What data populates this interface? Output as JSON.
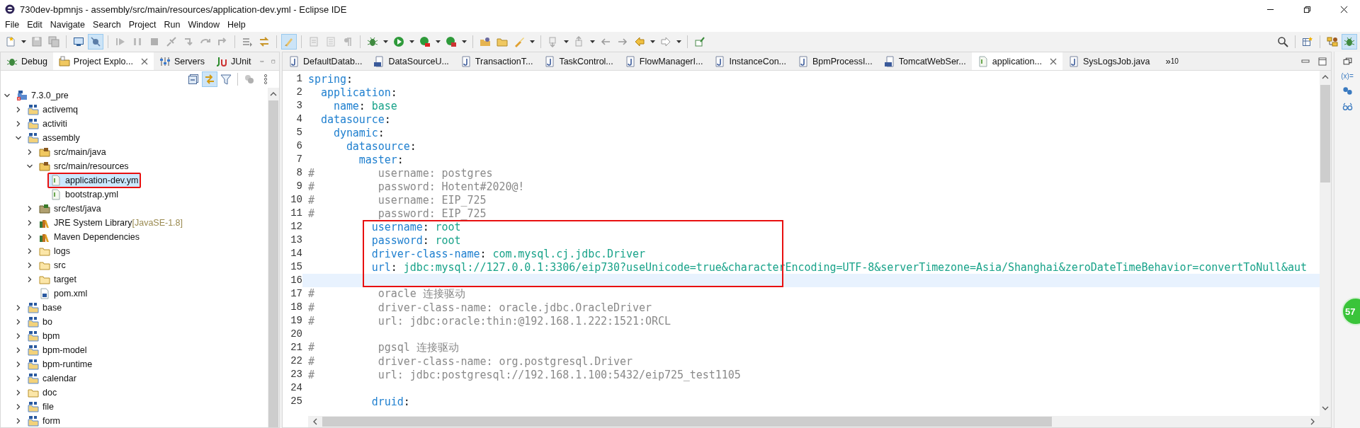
{
  "window": {
    "title": "730dev-bpmnjs - assembly/src/main/resources/application-dev.yml - Eclipse IDE"
  },
  "menu": [
    {
      "label": "File"
    },
    {
      "label": "Edit"
    },
    {
      "label": "Navigate"
    },
    {
      "label": "Search"
    },
    {
      "label": "Project"
    },
    {
      "label": "Run"
    },
    {
      "label": "Window"
    },
    {
      "label": "Help"
    }
  ],
  "toolbar": [
    {
      "on": false
    },
    {
      "on": false
    },
    {
      "on": false
    },
    {
      "on": false
    },
    {
      "on": true
    },
    {
      "on": false
    },
    {
      "on": false
    },
    {
      "on": false
    },
    {
      "on": false
    },
    {
      "on": false
    },
    {
      "on": false
    },
    {
      "on": false
    },
    {
      "on": false
    },
    {
      "on": false
    },
    {
      "on": true
    },
    {
      "on": false
    },
    {
      "on": false
    },
    {
      "on": false
    },
    {
      "on": false
    },
    {
      "on": false
    },
    {
      "on": false
    },
    {
      "on": false
    },
    {
      "on": false
    },
    {
      "on": false
    },
    {
      "on": false
    },
    {
      "on": false
    },
    {
      "on": false
    },
    {
      "on": false
    },
    {
      "on": false
    },
    {
      "on": false
    },
    {
      "on": false
    },
    {
      "on": false
    }
  ],
  "perspectives": [
    {
      "selected": false
    },
    {
      "selected": true
    }
  ],
  "left_panel": {
    "tabs": [
      {
        "label": "Debug",
        "kind": "debug",
        "selected": false
      },
      {
        "label": "Project Explo...",
        "kind": "explorer",
        "selected": true
      },
      {
        "label": "Servers",
        "kind": "servers",
        "selected": false
      },
      {
        "label": "JUnit",
        "kind": "junit",
        "selected": false
      }
    ],
    "tree": [
      {
        "label": "7.3.0_pre",
        "kind": "root",
        "expanded": true,
        "selected": false,
        "boxed": false,
        "children": [
          {
            "label": "activemq",
            "kind": "project",
            "expanded": false,
            "selected": false,
            "boxed": false
          },
          {
            "label": "activiti",
            "kind": "project",
            "expanded": false,
            "selected": false,
            "boxed": false
          },
          {
            "label": "assembly",
            "kind": "project",
            "expanded": true,
            "selected": false,
            "boxed": false,
            "children": [
              {
                "label": "src/main/java",
                "kind": "source",
                "expanded": false,
                "selected": false,
                "boxed": false
              },
              {
                "label": "src/main/resources",
                "kind": "source",
                "expanded": true,
                "selected": false,
                "boxed": false,
                "children": [
                  {
                    "label": "application-dev.ym",
                    "kind": "yml",
                    "selected": true,
                    "boxed": true
                  },
                  {
                    "label": "bootstrap.yml",
                    "kind": "yml",
                    "selected": false,
                    "boxed": false
                  }
                ]
              },
              {
                "label": "src/test/java",
                "kind": "test-source",
                "expanded": false,
                "selected": false,
                "boxed": false
              },
              {
                "label": "JRE System Library",
                "decoration": "[JavaSE-1.8]",
                "kind": "library",
                "expanded": false,
                "selected": false,
                "boxed": false
              },
              {
                "label": "Maven Dependencies",
                "kind": "library",
                "expanded": false,
                "selected": false,
                "boxed": false
              },
              {
                "label": "logs",
                "kind": "folder",
                "expanded": false,
                "selected": false,
                "boxed": false
              },
              {
                "label": "src",
                "kind": "folder",
                "expanded": false,
                "selected": false,
                "boxed": false
              },
              {
                "label": "target",
                "kind": "folder",
                "expanded": false,
                "selected": false,
                "boxed": false
              },
              {
                "label": "pom.xml",
                "kind": "pom",
                "selected": false,
                "boxed": false
              }
            ]
          },
          {
            "label": "base",
            "kind": "project",
            "expanded": false,
            "selected": false,
            "boxed": false
          },
          {
            "label": "bo",
            "kind": "project",
            "expanded": false,
            "selected": false,
            "boxed": false
          },
          {
            "label": "bpm",
            "kind": "project",
            "expanded": false,
            "selected": false,
            "boxed": false
          },
          {
            "label": "bpm-model",
            "kind": "project",
            "expanded": false,
            "selected": false,
            "boxed": false
          },
          {
            "label": "bpm-runtime",
            "kind": "project",
            "expanded": false,
            "selected": false,
            "boxed": false
          },
          {
            "label": "calendar",
            "kind": "project",
            "expanded": false,
            "selected": false,
            "boxed": false
          },
          {
            "label": "doc",
            "kind": "folder",
            "expanded": false,
            "selected": false,
            "boxed": false
          },
          {
            "label": "file",
            "kind": "project",
            "expanded": false,
            "selected": false,
            "boxed": false
          },
          {
            "label": "form",
            "kind": "project",
            "expanded": false,
            "selected": false,
            "boxed": false
          }
        ]
      }
    ]
  },
  "editor": {
    "tabs": [
      {
        "label": "DefaultDatab...",
        "kind": "java",
        "selected": false
      },
      {
        "label": "DataSourceU...",
        "kind": "class",
        "selected": false
      },
      {
        "label": "TransactionT...",
        "kind": "java",
        "selected": false
      },
      {
        "label": "TaskControl...",
        "kind": "java",
        "selected": false
      },
      {
        "label": "FlowManagerI...",
        "kind": "java",
        "selected": false
      },
      {
        "label": "InstanceCon...",
        "kind": "java",
        "selected": false
      },
      {
        "label": "BpmProcessI...",
        "kind": "java",
        "selected": false
      },
      {
        "label": "TomcatWebSer...",
        "kind": "class",
        "selected": false
      },
      {
        "label": "application...",
        "kind": "yml",
        "selected": true
      },
      {
        "label": "SysLogsJob.java",
        "kind": "java",
        "selected": false
      }
    ],
    "overflow_mark": "»",
    "overflow_count": "10",
    "lines": [
      {
        "number": "1",
        "kind": "pair",
        "key": "spring",
        "sep": ":",
        "current": false,
        "boxed": false
      },
      {
        "number": "2",
        "kind": "pair",
        "key": "  application",
        "sep": ":",
        "current": false,
        "boxed": false
      },
      {
        "number": "3",
        "kind": "pair",
        "key": "    name",
        "sep": ":",
        "value": " base",
        "current": false,
        "boxed": false
      },
      {
        "number": "4",
        "kind": "pair",
        "key": "  datasource",
        "sep": ":",
        "current": false,
        "boxed": false
      },
      {
        "number": "5",
        "kind": "pair",
        "key": "    dynamic",
        "sep": ":",
        "current": false,
        "boxed": false
      },
      {
        "number": "6",
        "kind": "pair",
        "key": "      datasource",
        "sep": ":",
        "current": false,
        "boxed": false
      },
      {
        "number": "7",
        "kind": "pair",
        "key": "        master",
        "sep": ":",
        "current": false,
        "boxed": false
      },
      {
        "number": "8",
        "kind": "comment",
        "text": "#          username: postgres",
        "current": false,
        "boxed": false
      },
      {
        "number": "9",
        "kind": "comment",
        "text": "#          password: Hotent#2020@!",
        "current": false,
        "boxed": false
      },
      {
        "number": "10",
        "kind": "comment",
        "text": "#          username: EIP_725",
        "current": false,
        "boxed": false
      },
      {
        "number": "11",
        "kind": "comment",
        "text": "#          password: EIP_725",
        "current": false,
        "boxed": false
      },
      {
        "number": "12",
        "kind": "pair",
        "key": "          username",
        "sep": ":",
        "value": " root",
        "current": false,
        "boxed": true
      },
      {
        "number": "13",
        "kind": "pair",
        "key": "          password",
        "sep": ":",
        "value": " root",
        "current": false,
        "boxed": true
      },
      {
        "number": "14",
        "kind": "pair",
        "key": "          driver-class-name",
        "sep": ":",
        "value": " com.mysql.cj.jdbc.Driver",
        "current": false,
        "boxed": true
      },
      {
        "number": "15",
        "kind": "pair",
        "key": "          url",
        "sep": ":",
        "value": " jdbc:mysql://127.0.0.1:3306/eip730?useUnicode=true&characterEncoding=UTF-8&serverTimezone=Asia/Shanghai&zeroDateTimeBehavior=convertToNull&aut",
        "current": false,
        "boxed": true
      },
      {
        "number": "16",
        "kind": "blank",
        "current": true,
        "boxed": true
      },
      {
        "number": "17",
        "kind": "comment",
        "text": "#          oracle 连接驱动",
        "current": false,
        "boxed": false
      },
      {
        "number": "18",
        "kind": "comment",
        "text": "#          driver-class-name: oracle.jdbc.OracleDriver",
        "current": false,
        "boxed": false
      },
      {
        "number": "19",
        "kind": "comment",
        "text": "#          url: jdbc:oracle:thin:@192.168.1.222:1521:ORCL",
        "current": false,
        "boxed": false
      },
      {
        "number": "20",
        "kind": "blank",
        "current": false,
        "boxed": false
      },
      {
        "number": "21",
        "kind": "comment",
        "text": "#          pgsql 连接驱动",
        "current": false,
        "boxed": false
      },
      {
        "number": "22",
        "kind": "comment",
        "text": "#          driver-class-name: org.postgresql.Driver",
        "current": false,
        "boxed": false
      },
      {
        "number": "23",
        "kind": "comment",
        "text": "#          url: jdbc:postgresql://192.168.1.100:5432/eip725_test1105",
        "current": false,
        "boxed": false
      },
      {
        "number": "24",
        "kind": "blank",
        "current": false,
        "boxed": false
      },
      {
        "number": "25",
        "kind": "pair",
        "key": "          druid",
        "sep": ":",
        "current": false,
        "boxed": false
      }
    ]
  },
  "right_trim": {
    "variables_glyph": "(x)="
  },
  "badge": "57"
}
